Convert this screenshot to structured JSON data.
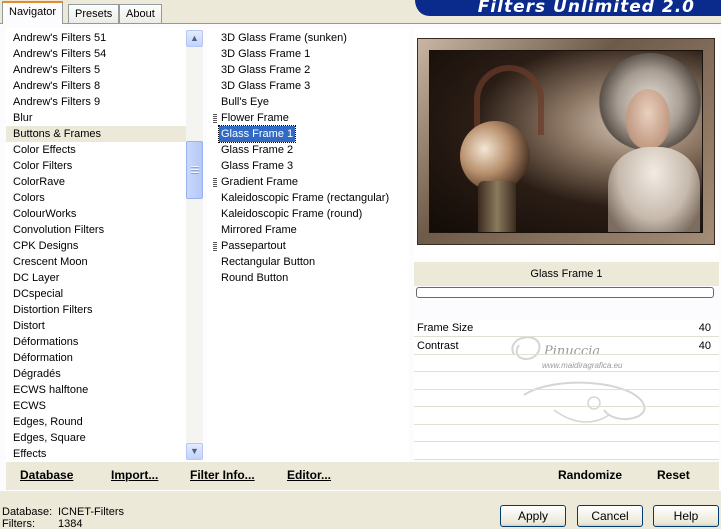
{
  "tabs": [
    "Navigator",
    "Presets",
    "About"
  ],
  "title": "Filters Unlimited 2.0",
  "categories": [
    "Andrew's Filters 51",
    "Andrew's Filters 54",
    "Andrew's Filters 5",
    "Andrew's Filters 8",
    "Andrew's Filters 9",
    "Blur",
    "Buttons & Frames",
    "Color Effects",
    "Color Filters",
    "ColorRave",
    "Colors",
    "ColourWorks",
    "Convolution Filters",
    "CPK Designs",
    "Crescent Moon",
    "DC Layer",
    "DCspecial",
    "Distortion Filters",
    "Distort",
    "Déformations",
    "Déformation",
    "Dégradés",
    "ECWS halftone",
    "ECWS",
    "Edges, Round",
    "Edges, Square",
    "Effects"
  ],
  "selected_category": "Buttons & Frames",
  "filters": [
    {
      "label": "3D Glass Frame (sunken)",
      "marked": false
    },
    {
      "label": "3D Glass Frame 1",
      "marked": false
    },
    {
      "label": "3D Glass Frame 2",
      "marked": false
    },
    {
      "label": "3D Glass Frame 3",
      "marked": false
    },
    {
      "label": "Bull's Eye",
      "marked": false
    },
    {
      "label": "Flower Frame",
      "marked": true
    },
    {
      "label": "Glass Frame 1",
      "marked": false
    },
    {
      "label": "Glass Frame 2",
      "marked": false
    },
    {
      "label": "Glass Frame 3",
      "marked": false
    },
    {
      "label": "Gradient Frame",
      "marked": true
    },
    {
      "label": "Kaleidoscopic Frame (rectangular)",
      "marked": false
    },
    {
      "label": "Kaleidoscopic Frame (round)",
      "marked": false
    },
    {
      "label": "Mirrored Frame",
      "marked": false
    },
    {
      "label": "Passepartout",
      "marked": true
    },
    {
      "label": "Rectangular Button",
      "marked": false
    },
    {
      "label": "Round Button",
      "marked": false
    }
  ],
  "selected_filter": "Glass Frame 1",
  "filter_name": "Glass Frame 1",
  "progress": 0,
  "params": [
    {
      "name": "Frame Size",
      "value": "40"
    },
    {
      "name": "Contrast",
      "value": "40"
    }
  ],
  "watermark": {
    "text": "Pinuccia",
    "sub": "www.maidiragrafica.eu"
  },
  "buttons": {
    "database": "Database",
    "import": "Import...",
    "filter_info": "Filter Info...",
    "editor": "Editor...",
    "randomize": "Randomize",
    "reset": "Reset",
    "apply": "Apply",
    "cancel": "Cancel",
    "help": "Help"
  },
  "footer": {
    "database_label": "Database:",
    "database_value": "ICNET-Filters",
    "filters_label": "Filters:",
    "filters_value": "1384"
  },
  "colors": {
    "selection": "#316ac5",
    "category_selected": "#ece9d8",
    "banner": "#0a2a8c"
  }
}
